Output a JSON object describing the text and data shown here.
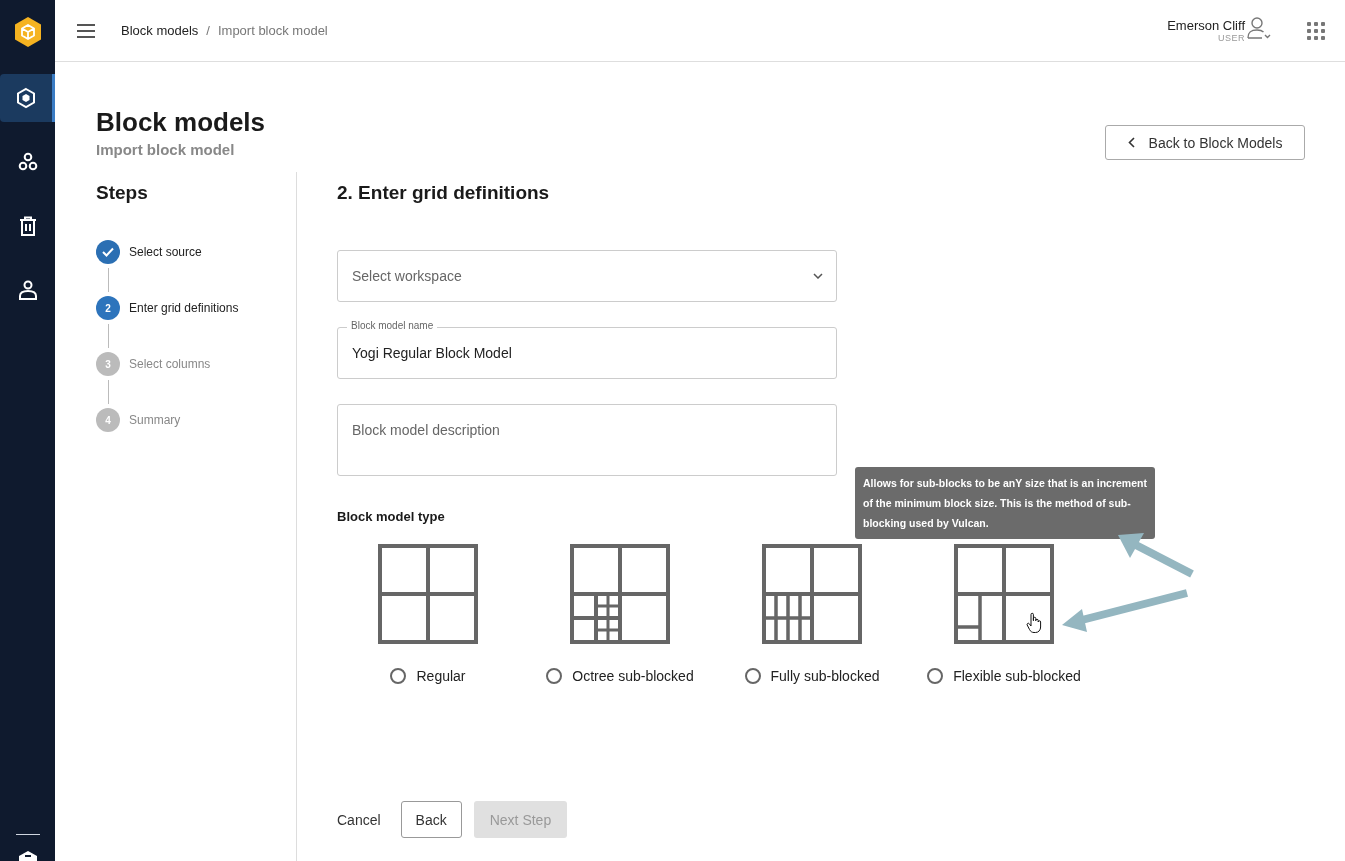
{
  "sidebar": {
    "items": [
      {
        "selected": true
      },
      {
        "selected": false
      },
      {
        "selected": false
      },
      {
        "selected": false
      }
    ]
  },
  "header": {
    "breadcrumbs": [
      "Block models",
      "Import block model"
    ],
    "breadcrumb_separator": "/",
    "user": {
      "name": "Emerson Cliff",
      "role": "USER"
    }
  },
  "page": {
    "title": "Block models",
    "subtitle": "Import block model",
    "back_button": "Back to Block Models"
  },
  "steps": {
    "title": "Steps",
    "items": [
      {
        "kind": "done",
        "label": "Select source"
      },
      {
        "kind": "current",
        "number": "2",
        "label": "Enter grid definitions"
      },
      {
        "kind": "pending",
        "number": "3",
        "label": "Select columns"
      },
      {
        "kind": "pending",
        "number": "4",
        "label": "Summary"
      }
    ]
  },
  "form": {
    "heading": "2. Enter grid definitions",
    "workspace": {
      "placeholder": "Select workspace"
    },
    "name": {
      "label": "Block model name",
      "value": "Yogi Regular Block Model"
    },
    "description": {
      "placeholder": "Block model description"
    },
    "type_label": "Block model type",
    "types": [
      {
        "kind": "regular",
        "label": "Regular",
        "selected": false
      },
      {
        "kind": "octree",
        "label": "Octree sub-blocked",
        "selected": false
      },
      {
        "kind": "fully",
        "label": "Fully sub-blocked",
        "selected": false
      },
      {
        "kind": "flexible",
        "label": "Flexible sub-blocked",
        "selected": false
      }
    ],
    "tooltip": "Allows for sub-blocks to be anY size that is an increment of the minimum block size. This is the method of sub-blocking used by Vulcan."
  },
  "footer": {
    "cancel": "Cancel",
    "back": "Back",
    "next": {
      "label": "Next Step",
      "disabled": true
    }
  }
}
